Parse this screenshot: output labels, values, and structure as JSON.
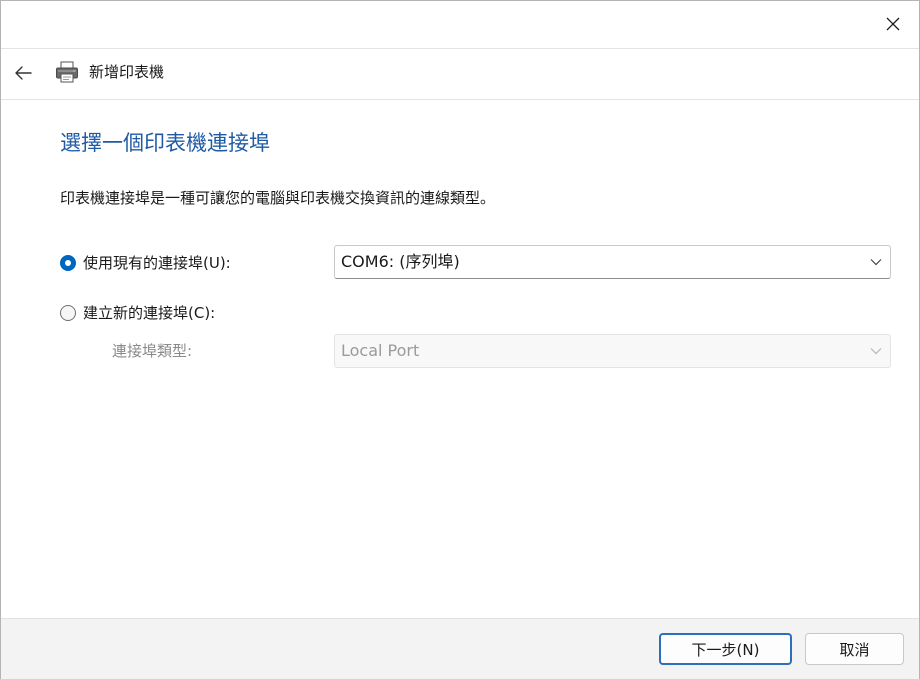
{
  "window": {
    "title": "新增印表機"
  },
  "icons": {
    "close": "close-icon",
    "back": "back-arrow-icon",
    "printer": "printer-icon",
    "chevron": "chevron-down-icon"
  },
  "colors": {
    "accent": "#0067c0",
    "heading": "#1f5aa6",
    "footer_bg": "#f3f3f3",
    "disabled_text": "#9a9a9a"
  },
  "main": {
    "heading": "選擇一個印表機連接埠",
    "description": "印表機連接埠是一種可讓您的電腦與印表機交換資訊的連線類型。",
    "option_existing": {
      "label": "使用現有的連接埠(U):",
      "selected": true,
      "select_value": "COM6: (序列埠)"
    },
    "option_new": {
      "label": "建立新的連接埠(C):",
      "selected": false,
      "port_type_label": "連接埠類型:",
      "select_value": "Local Port"
    }
  },
  "footer": {
    "next_label": "下一步(N)",
    "cancel_label": "取消"
  }
}
